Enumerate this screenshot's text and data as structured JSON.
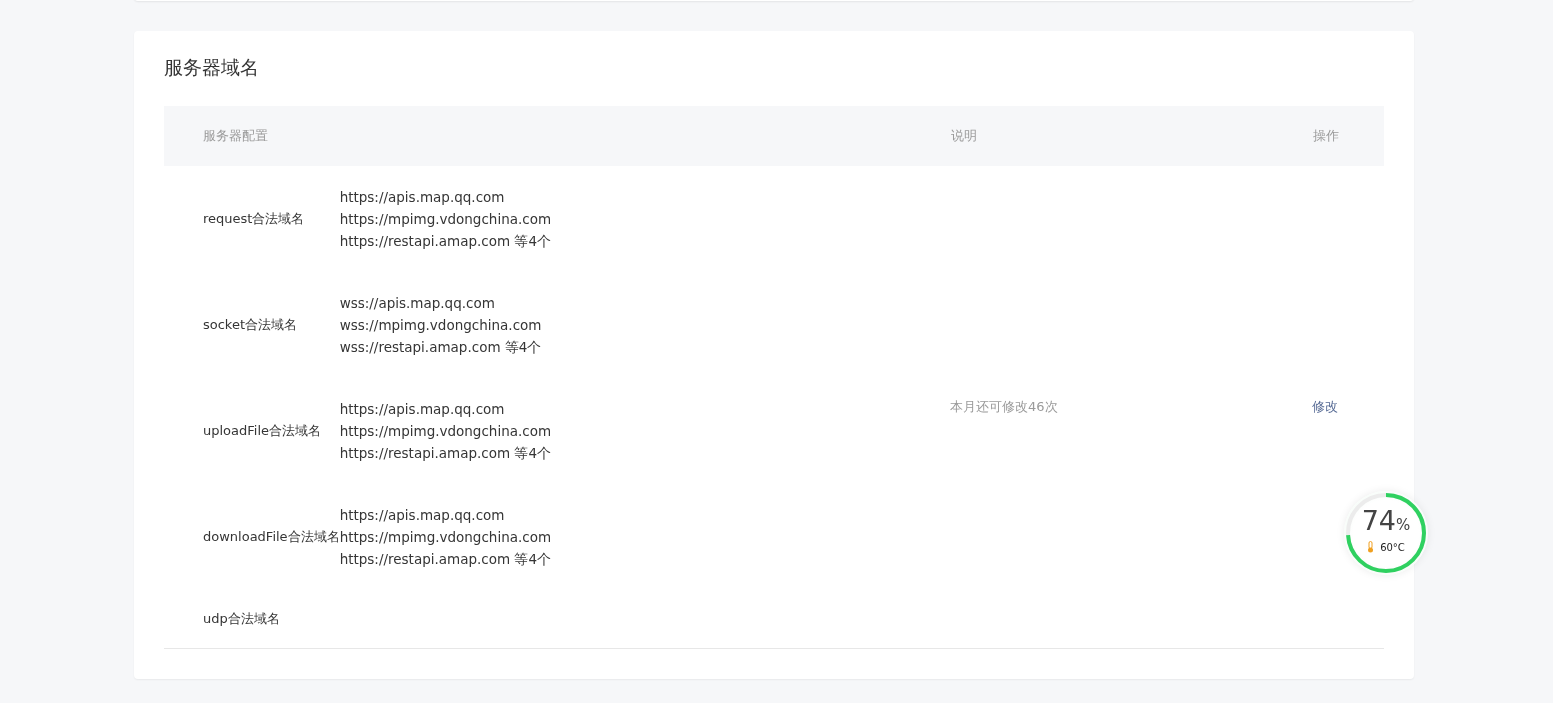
{
  "section": {
    "title": "服务器域名"
  },
  "table": {
    "columns": [
      "服务器配置",
      "说明",
      "操作"
    ],
    "rows": [
      {
        "name": "request合法域名",
        "domains": [
          "https://apis.map.qq.com",
          "https://mpimg.vdongchina.com",
          "https://restapi.amap.com 等4个"
        ]
      },
      {
        "name": "socket合法域名",
        "domains": [
          "wss://apis.map.qq.com",
          "wss://mpimg.vdongchina.com",
          "wss://restapi.amap.com 等4个"
        ]
      },
      {
        "name": "uploadFile合法域名",
        "domains": [
          "https://apis.map.qq.com",
          "https://mpimg.vdongchina.com",
          "https://restapi.amap.com 等4个"
        ]
      },
      {
        "name": "downloadFile合法域名",
        "domains": [
          "https://apis.map.qq.com",
          "https://mpimg.vdongchina.com",
          "https://restapi.amap.com 等4个"
        ]
      },
      {
        "name": "udp合法域名",
        "domains": []
      }
    ],
    "note": "本月还可修改46次",
    "action": "修改"
  },
  "monitor": {
    "level": 0.74,
    "value": "74",
    "unit": "%",
    "temperature": "60°C"
  }
}
